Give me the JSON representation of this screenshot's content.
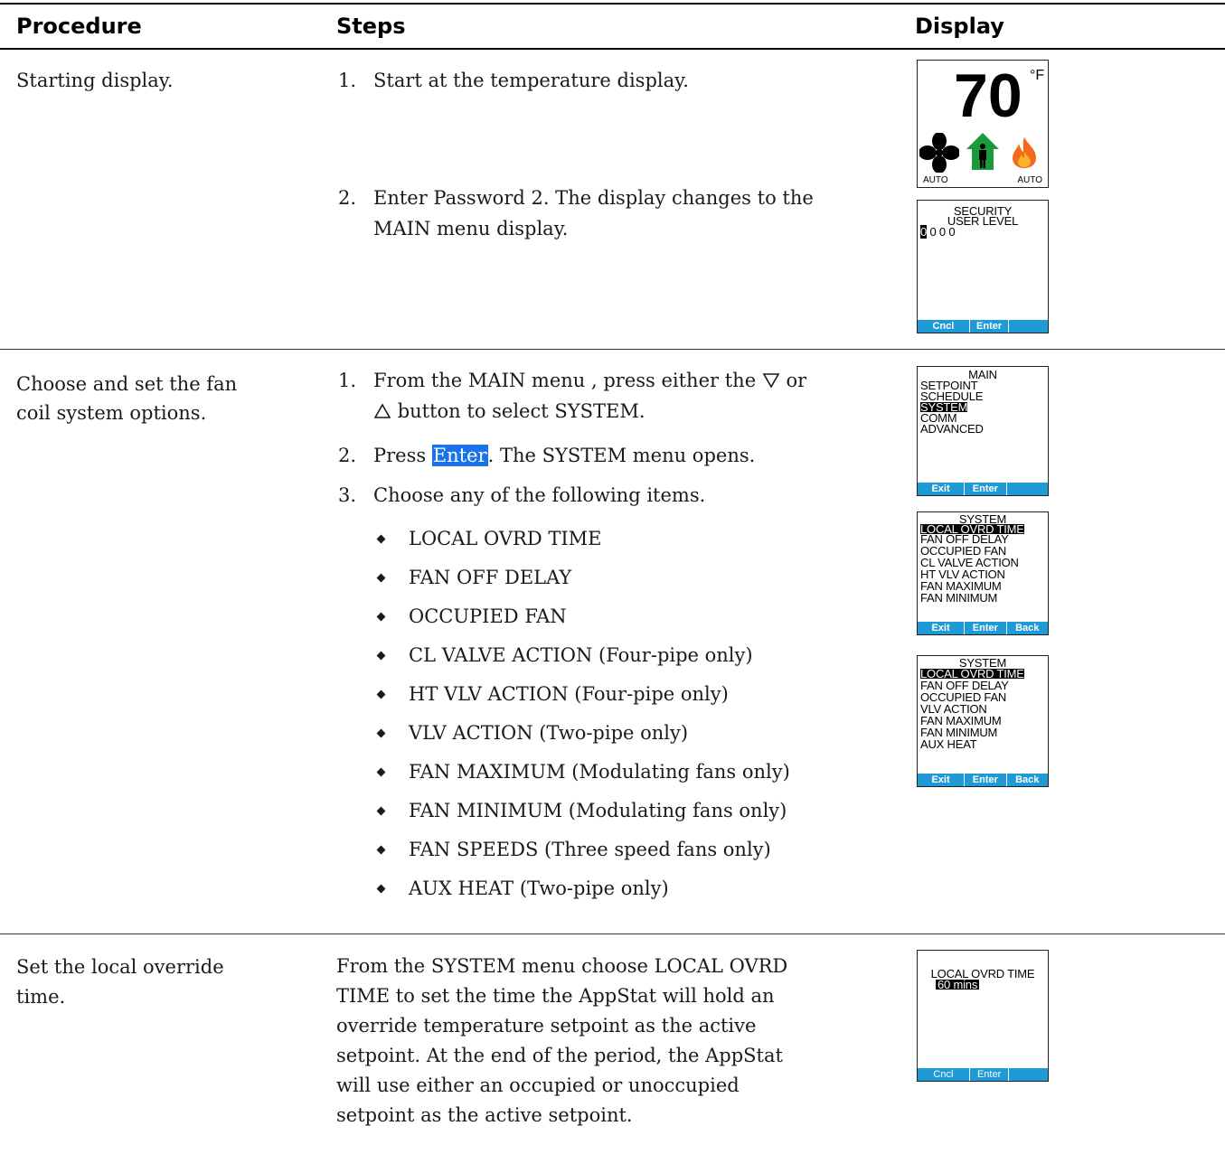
{
  "headers": {
    "procedure": "Procedure",
    "steps": "Steps",
    "display": "Display"
  },
  "row1": {
    "procedure": "Starting display.",
    "step1_num": "1.",
    "step1": "Start at the temperature display.",
    "step2_num": "2.",
    "step2_line1": "Enter Password 2. The display changes to the",
    "step2_line2": "MAIN menu display.",
    "temp_screen": {
      "temp": "70",
      "unit": "°F",
      "left_label": "AUTO",
      "right_label": "AUTO",
      "icons": [
        "fan-icon",
        "occupied-house-icon",
        "flame-icon"
      ]
    },
    "security_screen": {
      "title": "SECURITY",
      "subtitle": "USER LEVEL",
      "code_first": "0",
      "code_rest": " 0 0 0",
      "softkeys": [
        "Cncl",
        "Enter",
        ""
      ]
    }
  },
  "row2": {
    "procedure_line1": "Choose and set the fan",
    "procedure_line2": "coil system options.",
    "step1_num": "1.",
    "step1_line1": "From the MAIN menu , press either the",
    "step1_or": "or",
    "step1_line2": "button to select SYSTEM.",
    "step2_num": "2.",
    "step2_pre": "Press",
    "step2_hl": "Enter",
    "step2_post": ". The SYSTEM menu opens.",
    "step3_num": "3.",
    "step3": "Choose any of the following items.",
    "items": [
      "LOCAL OVRD TIME",
      "FAN OFF DELAY",
      "OCCUPIED FAN",
      "CL VALVE ACTION (Four-pipe only)",
      "HT VLV ACTION (Four-pipe only)",
      "VLV ACTION (Two-pipe only)",
      "FAN MAXIMUM (Modulating fans only)",
      "FAN MINIMUM (Modulating fans only)",
      "FAN SPEEDS (Three speed fans only)",
      "AUX HEAT (Two-pipe only)"
    ],
    "main_screen": {
      "title": "MAIN",
      "items": [
        "SETPOINT",
        "SCHEDULE",
        "SYSTEM",
        "COMM",
        "ADVANCED"
      ],
      "softkeys": [
        "Exit",
        "Enter",
        ""
      ]
    },
    "system_screen_a": {
      "title": "SYSTEM",
      "items": [
        "LOCAL OVRD TIME",
        "FAN OFF DELAY",
        "OCCUPIED FAN",
        "CL VALVE ACTION",
        "HT VLV ACTION",
        "FAN MAXIMUM",
        "FAN MINIMUM"
      ],
      "softkeys": [
        "Exit",
        "Enter",
        "Back"
      ]
    },
    "system_screen_b": {
      "title": "SYSTEM",
      "items": [
        "LOCAL OVRD TIME",
        "FAN OFF DELAY",
        "OCCUPIED FAN",
        "VLV ACTION",
        "FAN MAXIMUM",
        "FAN MINIMUM",
        "AUX HEAT"
      ],
      "softkeys": [
        "Exit",
        "Enter",
        "Back"
      ]
    }
  },
  "row3": {
    "procedure_line1": "Set the local override",
    "procedure_line2": "time.",
    "lines": [
      "From the SYSTEM menu choose LOCAL OVRD",
      "TIME to set the time the AppStat will hold an",
      "override temperature setpoint as the active",
      "setpoint. At the end of the period, the AppStat",
      "will use either an occupied or unoccupied",
      "setpoint as the active setpoint."
    ],
    "ovrd_screen": {
      "title": "LOCAL OVRD TIME",
      "value": "60 mins",
      "softkeys": [
        "Cncl",
        "Enter",
        ""
      ]
    }
  }
}
